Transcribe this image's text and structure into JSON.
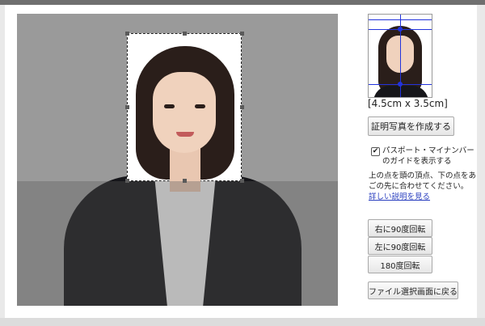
{
  "editor": {
    "crop_label": "crop-area"
  },
  "preview": {
    "size_label": "[4.5cm x 3.5cm]"
  },
  "actions": {
    "create_photo": "証明写真を作成する",
    "guide_checkbox_checked": true,
    "guide_checkbox_label": "パスポート・マイナンバーのガイドを表示する",
    "help_text": "上の点を頭の頂点、下の点をあごの先に合わせてください。",
    "help_link": "詳しい説明を見る",
    "rotate_right": "右に90度回転",
    "rotate_left": "左に90度回転",
    "rotate_180": "180度回転",
    "back_to_file_select": "ファイル選択画面に戻る"
  },
  "colors": {
    "guide": "#2233dd",
    "canvas_bg": "#9a9a9a",
    "link": "#2a3fbf"
  }
}
